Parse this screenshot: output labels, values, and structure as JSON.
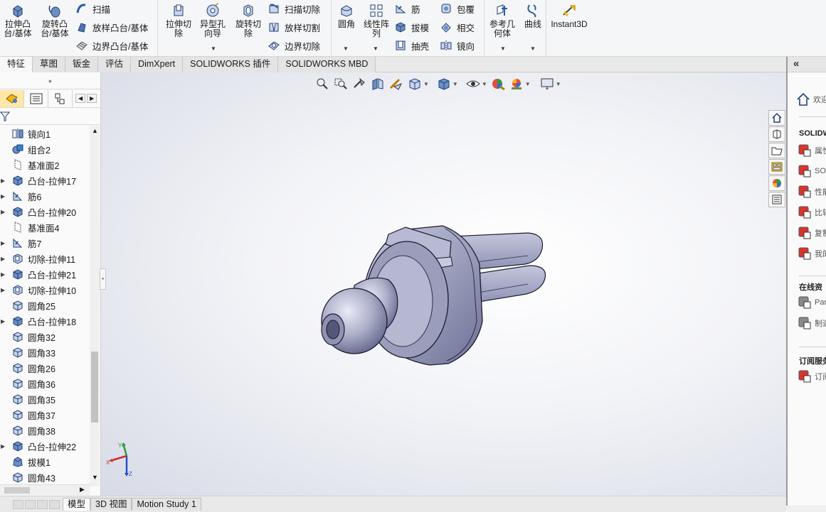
{
  "ribbon": {
    "big_buttons": {
      "extrude_boss": "拉伸凸\n台/基体",
      "revolve_boss": "旋转凸\n台/基体",
      "extrude_cut": "拉伸切\n除",
      "hole_wizard": "异型孔\n向导",
      "revolve_cut": "旋转切\n除",
      "fillet": "圆角",
      "linear_pattern": "线性阵\n列",
      "reference_geometry": "参考几\n何体",
      "curves": "曲线",
      "instant3d": "Instant3D"
    },
    "small_buttons": {
      "sweep": "扫描",
      "loft_boss": "放样凸台/基体",
      "boundary_boss": "边界凸台/基体",
      "swept_cut": "扫描切除",
      "lofted_cut": "放样切割",
      "boundary_cut": "边界切除",
      "rib": "筋",
      "draft": "拔模",
      "shell": "抽壳",
      "wrap": "包覆",
      "intersect": "相交",
      "mirror": "镜向"
    }
  },
  "command_tabs": [
    "特征",
    "草图",
    "钣金",
    "评估",
    "DimXpert",
    "SOLIDWORKS 插件",
    "SOLIDWORKS MBD"
  ],
  "active_command_tab": "特征",
  "feature_tree": {
    "items": [
      {
        "label": "镜向1",
        "icon": "mirror-feature-icon"
      },
      {
        "label": "组合2",
        "icon": "combine-feature-icon"
      },
      {
        "label": "基准面2",
        "icon": "plane-feature-icon"
      },
      {
        "label": "凸台-拉伸17",
        "icon": "boss-extrude-icon"
      },
      {
        "label": "筋6",
        "icon": "rib-feature-icon"
      },
      {
        "label": "凸台-拉伸20",
        "icon": "boss-extrude-icon"
      },
      {
        "label": "基准面4",
        "icon": "plane-feature-icon"
      },
      {
        "label": "筋7",
        "icon": "rib-feature-icon"
      },
      {
        "label": "切除-拉伸11",
        "icon": "cut-extrude-icon"
      },
      {
        "label": "凸台-拉伸21",
        "icon": "boss-extrude-icon"
      },
      {
        "label": "切除-拉伸10",
        "icon": "cut-extrude-icon"
      },
      {
        "label": "圆角25",
        "icon": "fillet-feature-icon"
      },
      {
        "label": "凸台-拉伸18",
        "icon": "boss-extrude-icon"
      },
      {
        "label": "圆角32",
        "icon": "fillet-feature-icon"
      },
      {
        "label": "圆角33",
        "icon": "fillet-feature-icon"
      },
      {
        "label": "圆角26",
        "icon": "fillet-feature-icon"
      },
      {
        "label": "圆角36",
        "icon": "fillet-feature-icon"
      },
      {
        "label": "圆角35",
        "icon": "fillet-feature-icon"
      },
      {
        "label": "圆角37",
        "icon": "fillet-feature-icon"
      },
      {
        "label": "圆角38",
        "icon": "fillet-feature-icon"
      },
      {
        "label": "凸台-拉伸22",
        "icon": "boss-extrude-icon"
      },
      {
        "label": "拔模1",
        "icon": "draft-feature-icon"
      },
      {
        "label": "圆角43",
        "icon": "fillet-feature-icon"
      }
    ]
  },
  "bottom_tabs": [
    "模型",
    "3D 视图",
    "Motion Study 1"
  ],
  "active_bottom_tab": "模型",
  "task_pane": {
    "collapse_label": "«",
    "home_label": "欢迎",
    "section_solidworks": "SOLIDW",
    "resource_items": [
      "属性",
      "SO",
      "性能",
      "比较",
      "复制",
      "我的"
    ],
    "section_online": "在线资",
    "online_items": [
      "Par",
      "制造"
    ],
    "section_subscription": "订阅服务",
    "subscription_items": [
      "订阅"
    ]
  },
  "triad_labels": {
    "x": "X",
    "y": "Y",
    "z": "Z"
  },
  "colors": {
    "accent_blue": "#2a6fc4",
    "model_gray": "#8d90b0",
    "tree_blue": "#3b7fc9"
  }
}
